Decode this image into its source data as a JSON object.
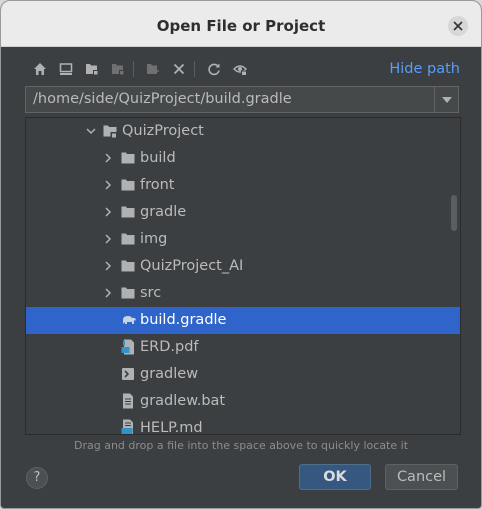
{
  "dialog": {
    "title": "Open File or Project",
    "close_icon": "close-icon"
  },
  "toolbar": {
    "icons": [
      "home-icon",
      "desktop-icon",
      "project-folder-icon",
      "module-folder-icon",
      "new-folder-icon",
      "delete-icon",
      "refresh-icon",
      "show-hidden-icon"
    ],
    "hide_path_label": "Hide path"
  },
  "path": {
    "value": "/home/side/QuizProject/build.gradle"
  },
  "tree": {
    "items": [
      {
        "label": "QuizProject",
        "type": "project-folder",
        "expanded": true,
        "selected": false
      },
      {
        "label": "build",
        "type": "folder",
        "expanded": false,
        "selected": false
      },
      {
        "label": "front",
        "type": "folder",
        "expanded": false,
        "selected": false
      },
      {
        "label": "gradle",
        "type": "folder",
        "expanded": false,
        "selected": false
      },
      {
        "label": "img",
        "type": "folder",
        "expanded": false,
        "selected": false
      },
      {
        "label": "QuizProject_AI",
        "type": "folder",
        "expanded": false,
        "selected": false
      },
      {
        "label": "src",
        "type": "folder",
        "expanded": false,
        "selected": false
      },
      {
        "label": "build.gradle",
        "type": "gradle-file",
        "selected": true
      },
      {
        "label": "ERD.pdf",
        "type": "pdf-file",
        "selected": false
      },
      {
        "label": "gradlew",
        "type": "shell-file",
        "selected": false
      },
      {
        "label": "gradlew.bat",
        "type": "text-file",
        "selected": false
      },
      {
        "label": "HELP.md",
        "type": "markdown-file",
        "selected": false
      }
    ]
  },
  "hint": "Drag and drop a file into the space above to quickly locate it",
  "buttons": {
    "help": "?",
    "ok": "OK",
    "cancel": "Cancel"
  },
  "colors": {
    "background": "#3c3f41",
    "selection": "#2f65ca",
    "link": "#589df6",
    "ok_button": "#365880"
  }
}
